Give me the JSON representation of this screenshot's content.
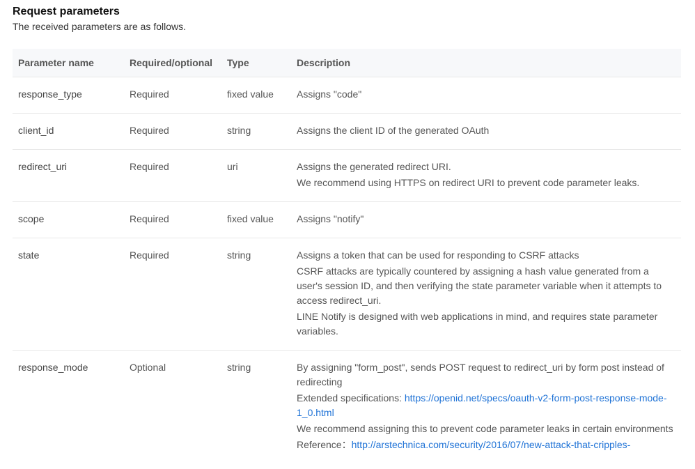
{
  "heading": "Request parameters",
  "subtitle": "The received parameters are as follows.",
  "headers": {
    "name": "Parameter name",
    "required": "Required/optional",
    "type": "Type",
    "description": "Description"
  },
  "rows": [
    {
      "name": "response_type",
      "required": "Required",
      "type": "fixed value",
      "desc": [
        {
          "t": "Assigns \"code\""
        }
      ]
    },
    {
      "name": "client_id",
      "required": "Required",
      "type": "string",
      "desc": [
        {
          "t": "Assigns the client ID of the generated OAuth"
        }
      ]
    },
    {
      "name": "redirect_uri",
      "required": "Required",
      "type": "uri",
      "desc": [
        {
          "t": "Assigns the generated redirect URI."
        },
        {
          "t": "We recommend using HTTPS on redirect URI to prevent code parameter leaks."
        }
      ]
    },
    {
      "name": "scope",
      "required": "Required",
      "type": "fixed value",
      "desc": [
        {
          "t": "Assigns \"notify\""
        }
      ]
    },
    {
      "name": "state",
      "required": "Required",
      "type": "string",
      "desc": [
        {
          "t": "Assigns a token that can be used for responding to CSRF attacks"
        },
        {
          "t": "CSRF attacks are typically countered by assigning a hash value generated from a user's session ID, and then verifying the state parameter variable when it attempts to access redirect_uri."
        },
        {
          "t": "LINE Notify is designed with web applications in mind, and requires state parameter variables."
        }
      ]
    },
    {
      "name": "response_mode",
      "required": "Optional",
      "type": "string",
      "desc": [
        {
          "t": "By assigning \"form_post\", sends POST request to redirect_uri by form post instead of redirecting"
        },
        {
          "t": "Extended specifications: ",
          "link": "https://openid.net/specs/oauth-v2-form-post-response-mode-1_0.html"
        },
        {
          "t": "We recommend assigning this to prevent code parameter leaks in certain environments"
        },
        {
          "t": "Reference：",
          "link": "http://arstechnica.com/security/2016/07/new-attack-that-cripples-"
        }
      ]
    }
  ]
}
